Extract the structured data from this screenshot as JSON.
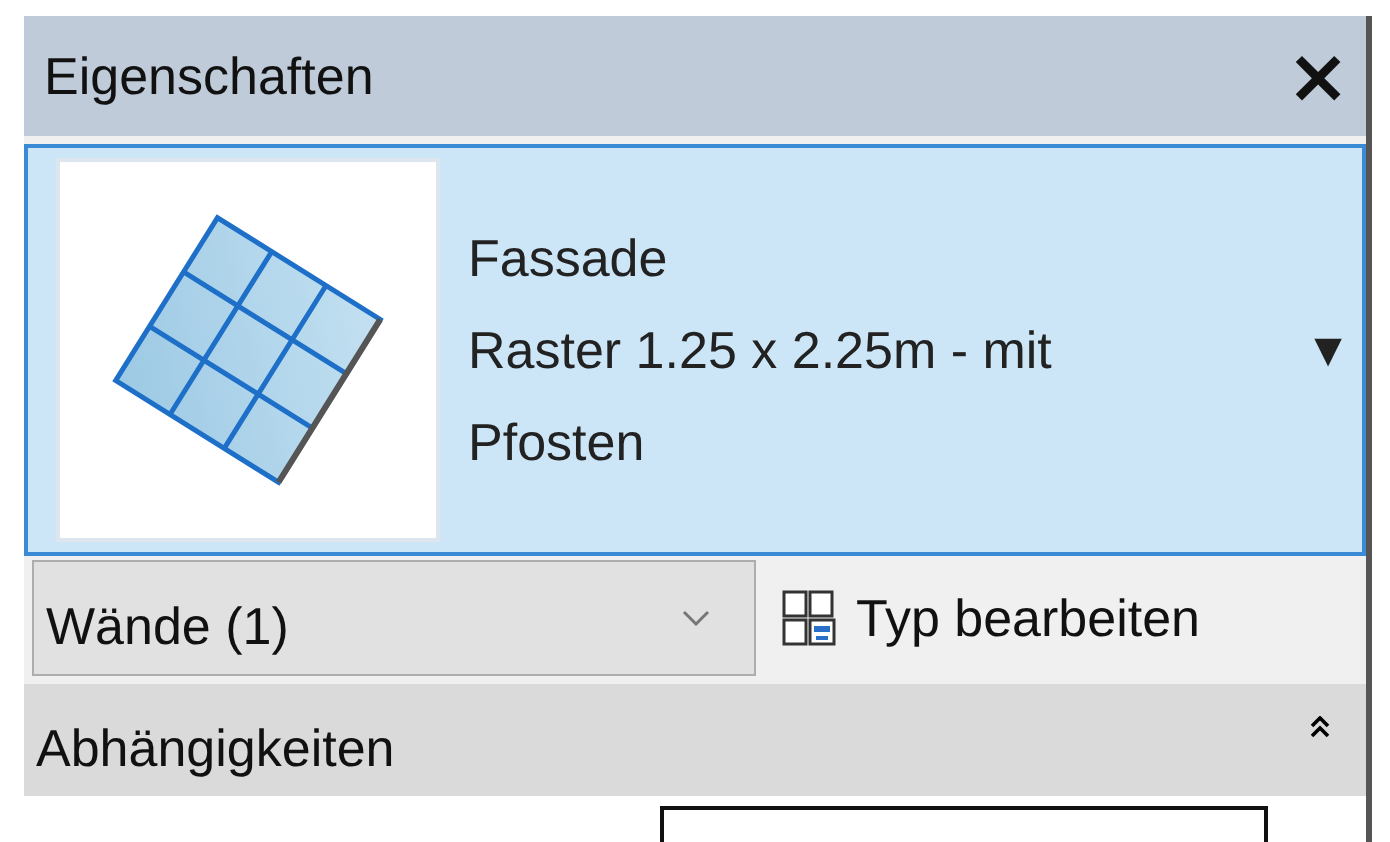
{
  "panel": {
    "title": "Eigenschaften",
    "close": "×"
  },
  "type_selector": {
    "family": "Fassade",
    "type_lines": [
      "Raster 1.25 x 2.25m - mit",
      "Pfosten"
    ],
    "arrow": "▼"
  },
  "filter": {
    "value": "Wände (1)"
  },
  "edit_type_button": {
    "label": "Typ bearbeiten"
  },
  "sections": [
    {
      "title": "Abhängigkeiten",
      "expanded": true
    }
  ]
}
